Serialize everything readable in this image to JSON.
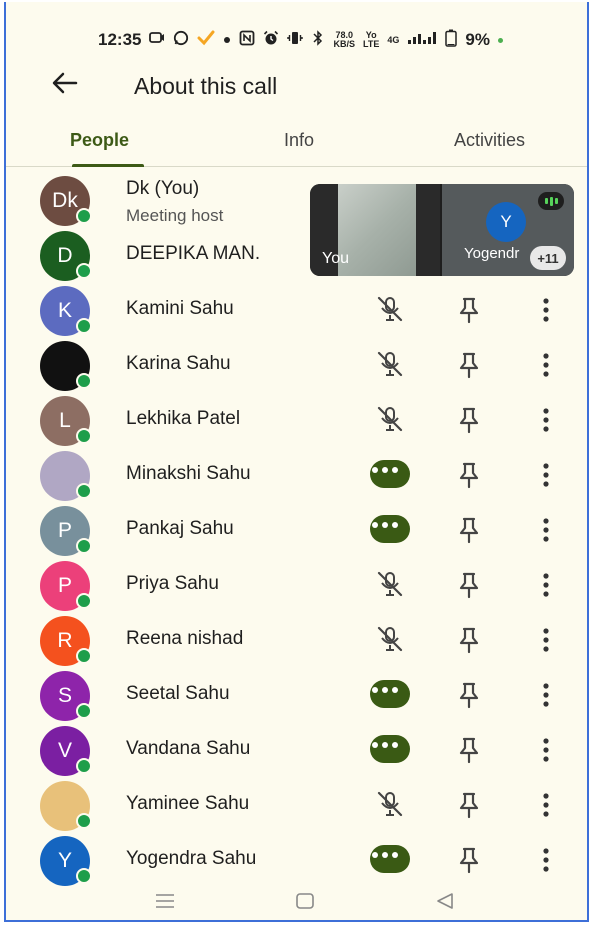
{
  "status_bar": {
    "time": "12:35",
    "net_speed_value": "78.0",
    "net_speed_unit": "KB/S",
    "volte_top": "Yo",
    "volte_bottom": "LTE",
    "network_type": "4G",
    "battery": "9%"
  },
  "header": {
    "title": "About this call"
  },
  "tabs": [
    {
      "label": "People",
      "active": true
    },
    {
      "label": "Info",
      "active": false
    },
    {
      "label": "Activities",
      "active": false
    }
  ],
  "pip": {
    "self_label": "You",
    "other_initial": "Y",
    "other_name": "Yogendr",
    "more_count": "+11"
  },
  "people": [
    {
      "initials": "Dk",
      "name": "Dk (You)",
      "subtitle": "Meeting host",
      "color": "#6d4c41",
      "mic": "none"
    },
    {
      "initials": "D",
      "name": "DEEPIKA MAN.",
      "subtitle": "",
      "color": "#1b5e20",
      "mic": "none"
    },
    {
      "initials": "K",
      "name": "Kamini Sahu",
      "subtitle": "",
      "color": "#5c6bc0",
      "mic": "muted"
    },
    {
      "initials": "",
      "name": "Karina Sahu",
      "subtitle": "",
      "color": "#111111",
      "mic": "muted"
    },
    {
      "initials": "L",
      "name": "Lekhika Patel",
      "subtitle": "",
      "color": "#8d6e63",
      "mic": "muted"
    },
    {
      "initials": "",
      "name": "Minakshi Sahu",
      "subtitle": "",
      "color": "#b0a7c4",
      "mic": "speaking"
    },
    {
      "initials": "P",
      "name": "Pankaj Sahu",
      "subtitle": "",
      "color": "#78909c",
      "mic": "speaking"
    },
    {
      "initials": "P",
      "name": "Priya Sahu",
      "subtitle": "",
      "color": "#ec407a",
      "mic": "muted"
    },
    {
      "initials": "R",
      "name": "Reena nishad",
      "subtitle": "",
      "color": "#f4511e",
      "mic": "muted"
    },
    {
      "initials": "S",
      "name": "Seetal Sahu",
      "subtitle": "",
      "color": "#8e24aa",
      "mic": "speaking"
    },
    {
      "initials": "V",
      "name": "Vandana Sahu",
      "subtitle": "",
      "color": "#7b1fa2",
      "mic": "speaking"
    },
    {
      "initials": "",
      "name": "Yaminee Sahu",
      "subtitle": "",
      "color": "#e8c17a",
      "mic": "muted"
    },
    {
      "initials": "Y",
      "name": "Yogendra Sahu",
      "subtitle": "",
      "color": "#1565c0",
      "mic": "speaking"
    }
  ],
  "colors": {
    "accent": "#3d5a16",
    "online": "#1e9e4a",
    "background": "#fdfbee"
  }
}
